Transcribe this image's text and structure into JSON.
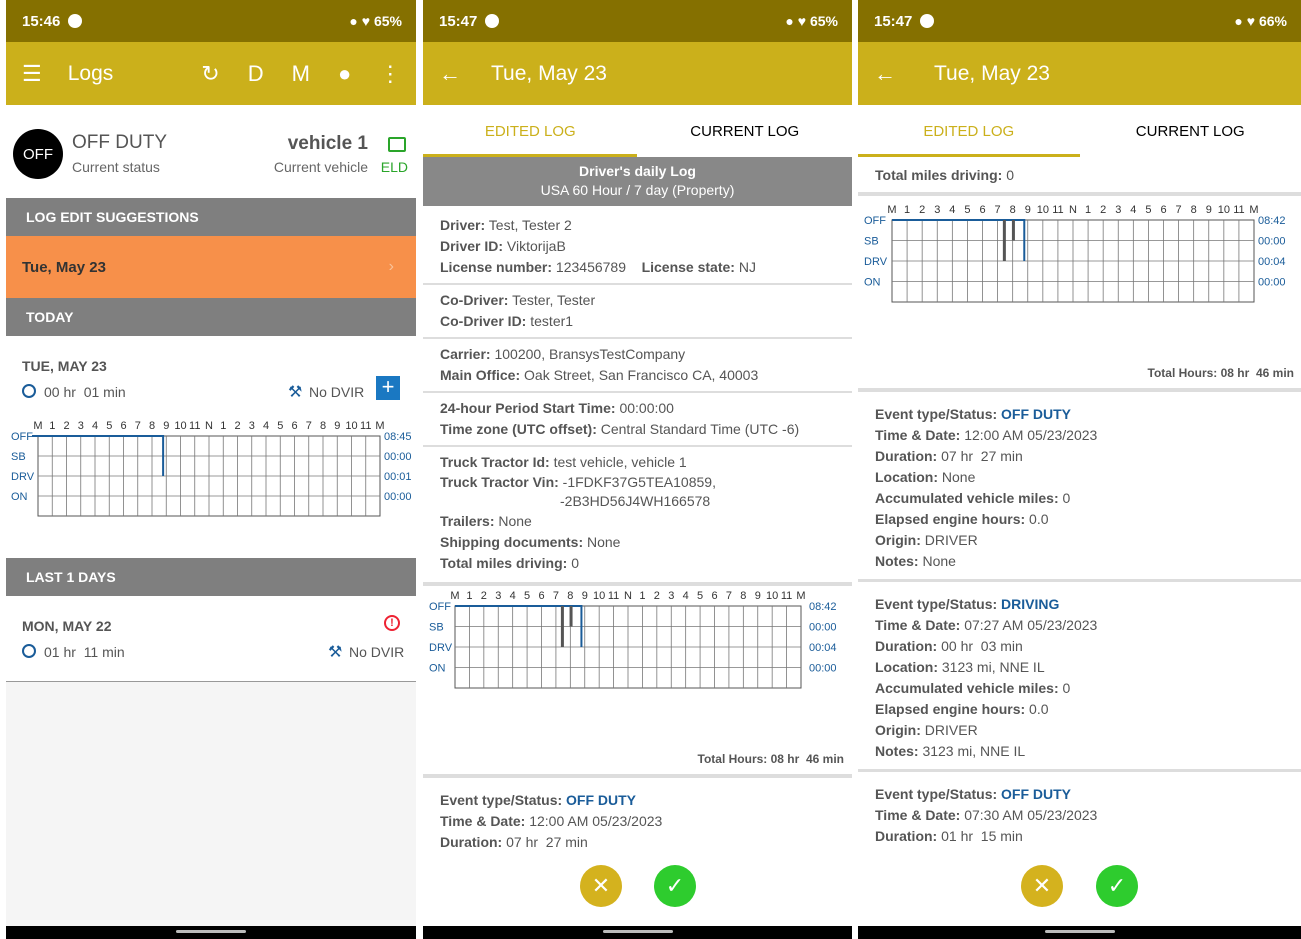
{
  "p1": {
    "status": {
      "time": "15:46",
      "battery": "65%"
    },
    "appbar": {
      "title": "Logs",
      "icons": [
        "menu-icon",
        "sync-icon",
        "D",
        "M",
        "location-icon",
        "more-icon"
      ],
      "d_label": "D",
      "m_label": "M"
    },
    "current": {
      "badge": "OFF",
      "status": "OFF DUTY",
      "status_sub": "Current status",
      "vehicle": "vehicle 1",
      "vehicle_sub": "Current vehicle",
      "eld": "ELD"
    },
    "suggestions": {
      "header": "LOG EDIT SUGGESTIONS",
      "item": "Tue, May 23"
    },
    "today": {
      "header": "TODAY",
      "date": "TUE, MAY 23",
      "duration": "00 hr  01 min",
      "dvir": "No DVIR",
      "hours": [
        "08:45",
        "00:00",
        "00:01",
        "00:00"
      ]
    },
    "last": {
      "header": "LAST 1 DAYS",
      "date": "MON, MAY 22",
      "duration": "01 hr  11 min",
      "dvir": "No DVIR"
    }
  },
  "grid": {
    "hour_labels": [
      "M",
      "1",
      "2",
      "3",
      "4",
      "5",
      "6",
      "7",
      "8",
      "9",
      "10",
      "11",
      "N",
      "1",
      "2",
      "3",
      "4",
      "5",
      "6",
      "7",
      "8",
      "9",
      "10",
      "11",
      "M"
    ],
    "row_labels": [
      "OFF",
      "SB",
      "DRV",
      "ON"
    ]
  },
  "p2": {
    "status": {
      "time": "15:47",
      "battery": "65%"
    },
    "appbar": {
      "title": "Tue, May 23"
    },
    "tabs": {
      "edited": "EDITED LOG",
      "current": "CURRENT LOG"
    },
    "banner": {
      "title": "Driver's daily Log",
      "sub": "USA 60 Hour / 7 day (Property)"
    },
    "driver": {
      "name_l": "Driver:",
      "name": "Test, Tester 2",
      "id_l": "Driver ID:",
      "id": "ViktorijaB",
      "lic_l": "License number:",
      "lic": "123456789",
      "state_l": "License state:",
      "state": "NJ"
    },
    "codriver": {
      "name_l": "Co-Driver:",
      "name": "Tester, Tester",
      "id_l": "Co-Driver ID:",
      "id": "tester1"
    },
    "carrier": {
      "carrier_l": "Carrier:",
      "carrier": "100200, BransysTestCompany",
      "office_l": "Main Office:",
      "office": "Oak Street, San Francisco CA, 40003"
    },
    "period": {
      "start_l": "24-hour Period Start Time:",
      "start": "00:00:00",
      "tz_l": "Time zone (UTC offset):",
      "tz": "Central Standard Time (UTC -6)"
    },
    "truck": {
      "id_l": "Truck Tractor Id:",
      "id": "test vehicle, vehicle 1",
      "vin_l": "Truck Tractor Vin:",
      "vin1": "-1FDKF37G5TEA10859,",
      "vin2": "-2B3HD56J4WH166578",
      "trailers_l": "Trailers:",
      "trailers": "None",
      "ship_l": "Shipping documents:",
      "ship": "None",
      "miles_l": "Total miles driving:",
      "miles": "0"
    },
    "hours": [
      "08:42",
      "00:00",
      "00:04",
      "00:00"
    ],
    "total": "Total Hours: 08 hr  46 min",
    "event": {
      "type_l": "Event type/Status:",
      "type": "OFF DUTY",
      "time_l": "Time & Date:",
      "time": "12:00 AM 05/23/2023",
      "dur_l": "Duration:",
      "dur": "07 hr  27 min"
    }
  },
  "p3": {
    "status": {
      "time": "15:47",
      "battery": "66%"
    },
    "appbar": {
      "title": "Tue, May 23"
    },
    "tabs": {
      "edited": "EDITED LOG",
      "current": "CURRENT LOG"
    },
    "miles": {
      "label": "Total miles driving:",
      "value": "0"
    },
    "hours": [
      "08:42",
      "00:00",
      "00:04",
      "00:00"
    ],
    "total": "Total Hours: 08 hr  46 min",
    "events": [
      {
        "type_l": "Event type/Status:",
        "type": "OFF DUTY",
        "time_l": "Time & Date:",
        "time": "12:00 AM 05/23/2023",
        "dur_l": "Duration:",
        "dur": "07 hr  27 min",
        "loc_l": "Location:",
        "loc": "None",
        "acc_l": "Accumulated vehicle miles:",
        "acc": "0",
        "eng_l": "Elapsed engine hours:",
        "eng": "0.0",
        "orig_l": "Origin:",
        "orig": "DRIVER",
        "notes_l": "Notes:",
        "notes": "None"
      },
      {
        "type_l": "Event type/Status:",
        "type": "DRIVING",
        "time_l": "Time & Date:",
        "time": "07:27 AM 05/23/2023",
        "dur_l": "Duration:",
        "dur": "00 hr  03 min",
        "loc_l": "Location:",
        "loc": "3123 mi, NNE IL",
        "acc_l": "Accumulated vehicle miles:",
        "acc": "0",
        "eng_l": "Elapsed engine hours:",
        "eng": "0.0",
        "orig_l": "Origin:",
        "orig": "DRIVER",
        "notes_l": "Notes:",
        "notes": "3123 mi, NNE IL"
      },
      {
        "type_l": "Event type/Status:",
        "type": "OFF DUTY",
        "time_l": "Time & Date:",
        "time": "07:30 AM 05/23/2023",
        "dur_l": "Duration:",
        "dur": "01 hr  15 min"
      }
    ]
  },
  "colors": {
    "status_bar": "#857000",
    "app_bar": "#cbb01b",
    "suggestion": "#f7904a",
    "section": "#7f7f7f",
    "blue": "#1a5c99",
    "green": "#2ecc2e",
    "reject": "#d4b21e"
  }
}
